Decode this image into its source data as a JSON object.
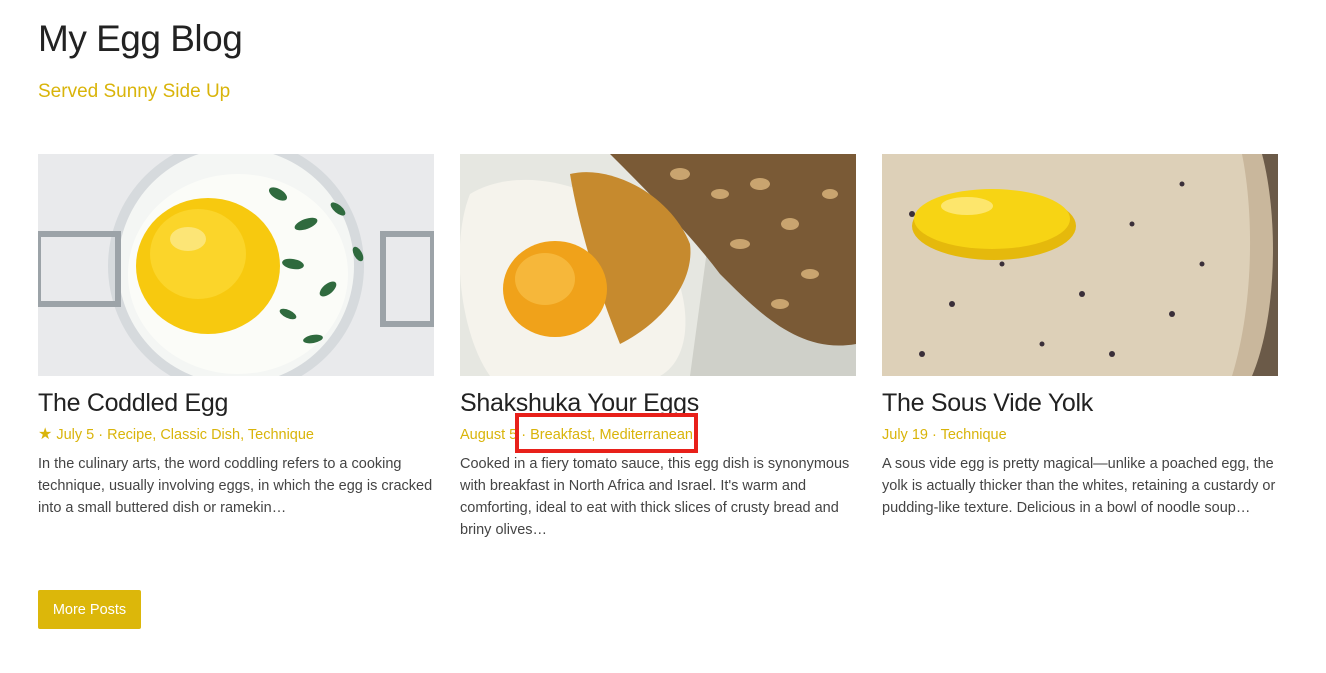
{
  "site": {
    "title": "My Egg Blog",
    "tagline": "Served Sunny Side Up"
  },
  "posts": [
    {
      "title": "The Coddled Egg",
      "featured": true,
      "date": "July 5",
      "separator": " · ",
      "categories": [
        "Recipe",
        "Classic Dish",
        "Technique"
      ],
      "excerpt": "In the culinary arts, the word coddling refers to a cooking technique, usually involving eggs, in which the egg is cracked into a small buttered dish or ramekin…"
    },
    {
      "title": "Shakshuka Your Eggs",
      "featured": false,
      "date": "August 5",
      "separator": " · ",
      "categories": [
        "Breakfast",
        "Mediterranean"
      ],
      "excerpt": "Cooked in a fiery tomato sauce, this egg dish is synonymous with breakfast in North Africa and Israel. It's warm and comforting, ideal to eat with thick slices of crusty bread and briny olives…"
    },
    {
      "title": "The Sous Vide Yolk",
      "featured": false,
      "date": "July 19",
      "separator": " · ",
      "categories": [
        "Technique"
      ],
      "excerpt": "A sous vide egg is pretty magical—unlike a poached egg, the yolk is actually thicker than the whites, retaining a custardy or pudding-like texture. Delicious in a bowl of noodle soup…"
    }
  ],
  "more_posts_label": "More Posts",
  "colors": {
    "accent": "#d9b40a",
    "button": "#dcb70a",
    "highlight": "#e8201a"
  }
}
